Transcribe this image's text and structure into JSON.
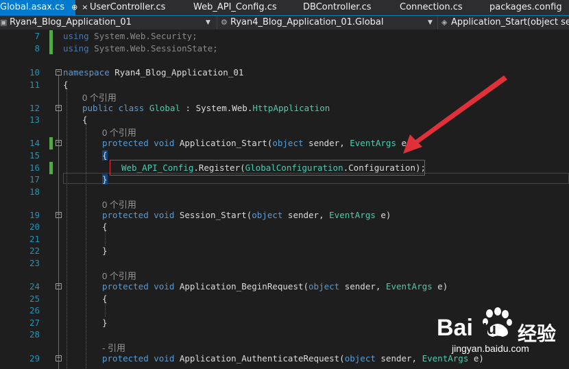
{
  "tabs": [
    {
      "label": "Global.asax.cs",
      "active": true,
      "pin": "⊕",
      "close": "×"
    },
    {
      "label": "UserController.cs",
      "active": false
    },
    {
      "label": "Web_API_Config.cs",
      "active": false
    },
    {
      "label": "DBController.cs",
      "active": false
    },
    {
      "label": "Connection.cs",
      "active": false
    },
    {
      "label": "packages.config",
      "active": false
    }
  ],
  "navbar": {
    "project": "Ryan4_Blog_Application_01",
    "type": "Ryan4_Blog_Application_01.Global",
    "member": "Application_Start(object sender"
  },
  "lines": {
    "l7": {
      "num": "7",
      "a": "using",
      "b": " System.Web.Security;"
    },
    "l8": {
      "num": "8",
      "a": "using",
      "b": " System.Web.SessionState;"
    },
    "l10": {
      "num": "10",
      "a": "namespace",
      "b": " Ryan4_Blog_Application_01"
    },
    "l11": {
      "num": "11",
      "text": "{"
    },
    "l12": {
      "num": "12",
      "a": "public class",
      "b": " Global",
      "c": " : System.Web.",
      "d": "HttpApplication"
    },
    "l13": {
      "num": "13",
      "text": "{"
    },
    "l14": {
      "num": "14",
      "a": "protected void",
      "b": " Application_Start(",
      "c": "object",
      "d": " sender, ",
      "e": "EventArgs",
      "f": " e)"
    },
    "l15": {
      "num": "15",
      "text": "{"
    },
    "l16": {
      "num": "16",
      "a": "Web_API_Config",
      "b": ".Register(",
      "c": "GlobalConfiguration",
      "d": ".Configuration);"
    },
    "l17": {
      "num": "17",
      "text": "}"
    },
    "l18": {
      "num": "18"
    },
    "l19": {
      "num": "19",
      "a": "protected void",
      "b": " Session_Start(",
      "c": "object",
      "d": " sender, ",
      "e": "EventArgs",
      "f": " e)"
    },
    "l20": {
      "num": "20",
      "text": "{"
    },
    "l21": {
      "num": "21"
    },
    "l22": {
      "num": "22",
      "text": "}"
    },
    "l23": {
      "num": "23"
    },
    "l24": {
      "num": "24",
      "a": "protected void",
      "b": " Application_BeginRequest(",
      "c": "object",
      "d": " sender, ",
      "e": "EventArgs",
      "f": " e)"
    },
    "l25": {
      "num": "25",
      "text": "{"
    },
    "l26": {
      "num": "26"
    },
    "l27": {
      "num": "27",
      "text": "}"
    },
    "l28": {
      "num": "28"
    },
    "l29": {
      "num": "29",
      "a": "protected void",
      "b": " Application_AuthenticateRequest(",
      "c": "object",
      "d": " sender, ",
      "e": "EventArgs",
      "f": " e)"
    }
  },
  "codelens": {
    "class_refs": "0 个引用",
    "start_refs": "0 个引用",
    "session_refs": "0 个引用",
    "begin_refs": "0 个引用",
    "auth_refs": "- 引用"
  },
  "watermark": {
    "brand": "Bai",
    "brand2": "du",
    "cn": "经验",
    "url": "jingyan.baidu.com"
  },
  "colors": {
    "keyword": "#569cd6",
    "type": "#4ec9b0",
    "linenum": "#2b91af",
    "accent": "#007acc",
    "annotation": "#e0313a",
    "change": "#57a64a"
  }
}
